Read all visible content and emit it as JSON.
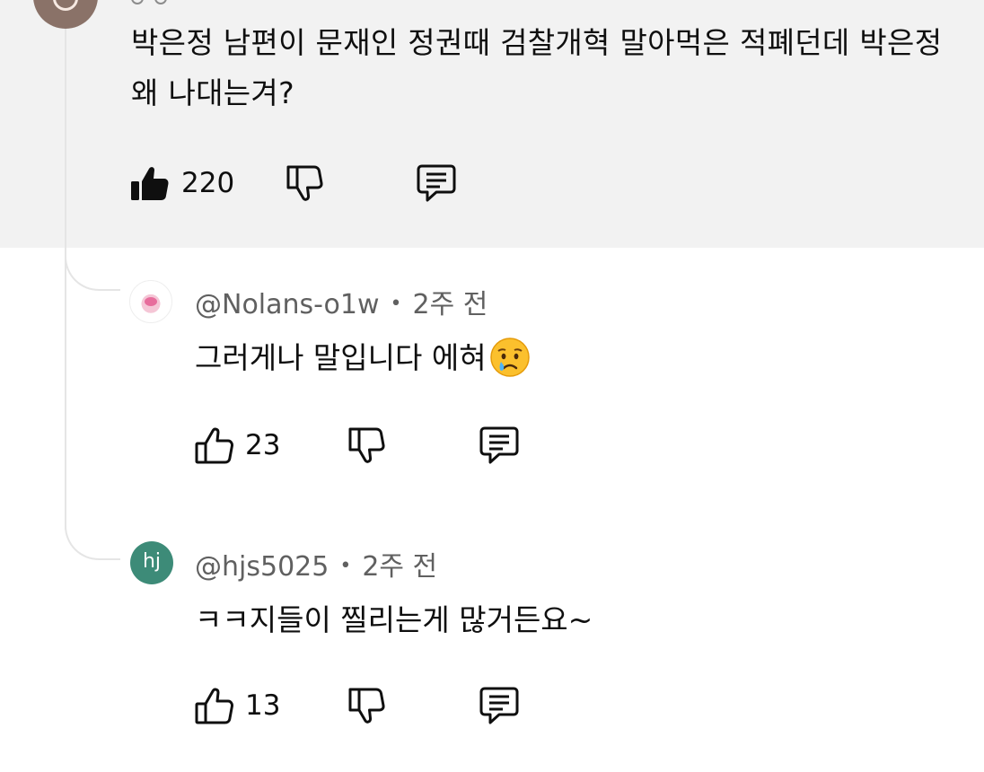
{
  "parent_comment": {
    "text": "박은정 남편이 문재인 정권때 검찰개혁 말아먹은 적폐던데 박은정 왜 나대는겨?",
    "likes": "220"
  },
  "replies": [
    {
      "author": "@Nolans-o1w",
      "time": "2주 전",
      "text": "그러게나 말입니다 에혀",
      "likes": "23",
      "emoji": "crying-face"
    },
    {
      "author": "@hjs5025",
      "avatar_initials": "hj",
      "avatar_color": "#3d8b78",
      "time": "2주 전",
      "text": "ㅋㅋ지들이 찔리는게 많거든요~",
      "likes": "13"
    }
  ],
  "separator": "•",
  "colors": {
    "parent_background": "#f2f2f2",
    "meta_text": "#606060",
    "thread_line": "#e5e5e5"
  }
}
